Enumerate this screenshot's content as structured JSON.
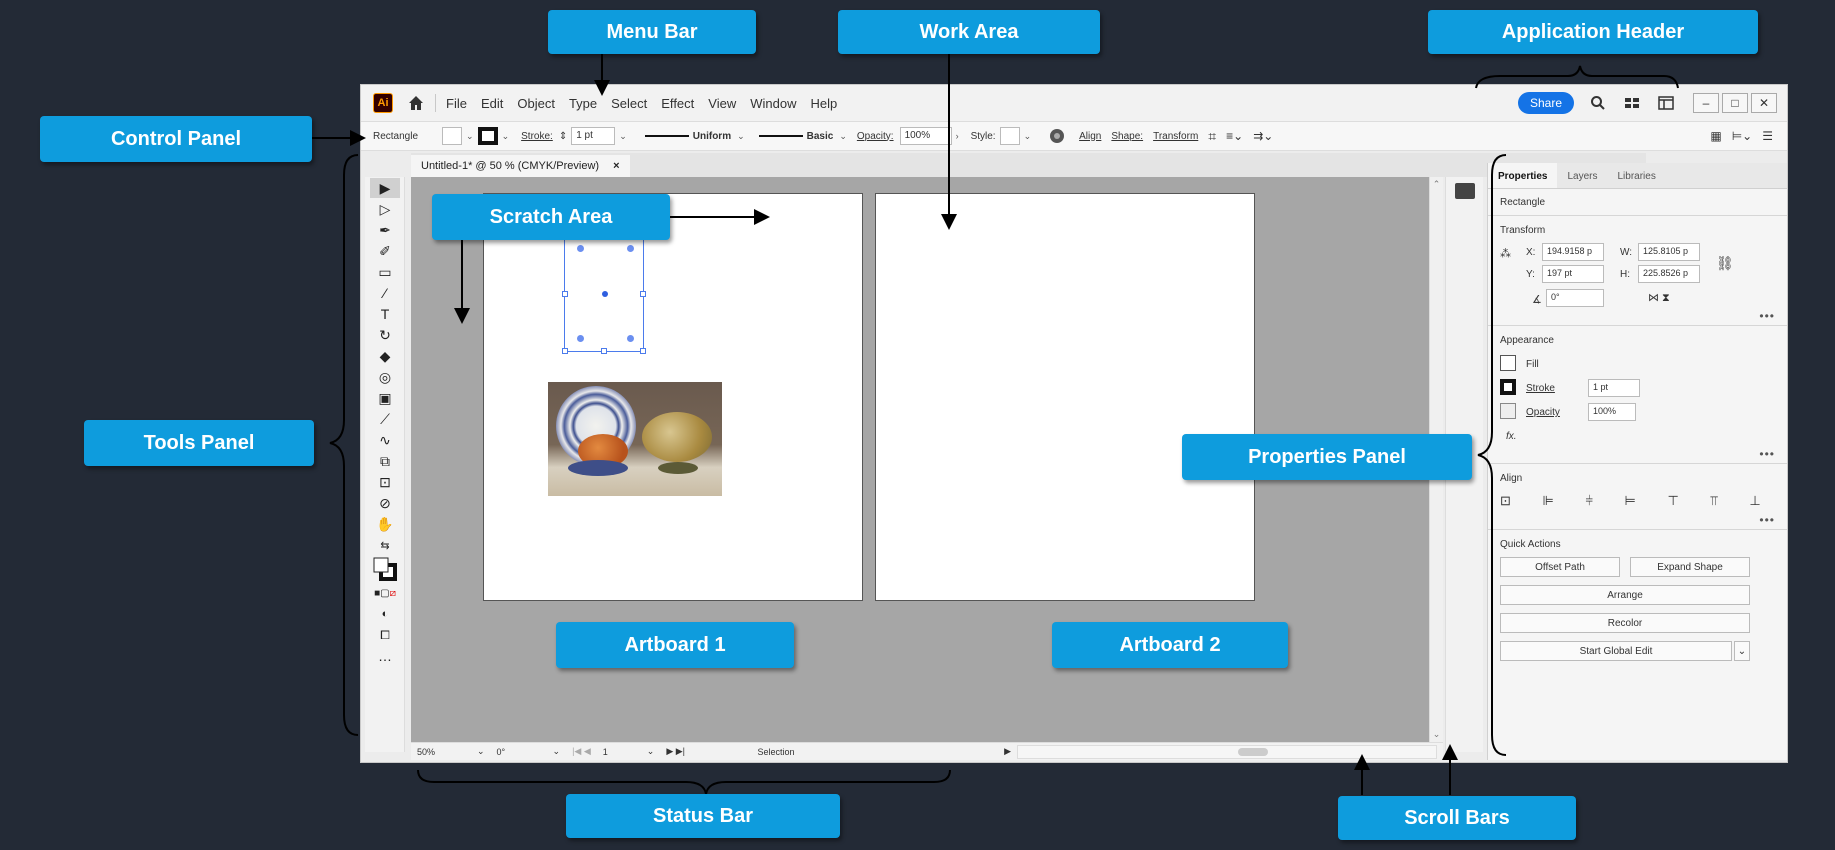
{
  "callouts": {
    "menu_bar": "Menu Bar",
    "work_area": "Work Area",
    "application_header": "Application Header",
    "control_panel": "Control Panel",
    "scratch_area": "Scratch Area",
    "tools_panel": "Tools Panel",
    "properties_panel": "Properties Panel",
    "artboard_1": "Artboard 1",
    "artboard_2": "Artboard 2",
    "status_bar": "Status Bar",
    "scroll_bars": "Scroll Bars"
  },
  "header": {
    "logo": "Ai",
    "menu": [
      "File",
      "Edit",
      "Object",
      "Type",
      "Select",
      "Effect",
      "View",
      "Window",
      "Help"
    ],
    "share_label": "Share"
  },
  "control_panel": {
    "object_label": "Rectangle",
    "stroke_label": "Stroke:",
    "stroke_value": "1 pt",
    "profile_label": "Uniform",
    "brush_label": "Basic",
    "opacity_label": "Opacity:",
    "opacity_value": "100%",
    "style_label": "Style:",
    "align_label": "Align",
    "shape_label": "Shape:",
    "transform_label": "Transform"
  },
  "document": {
    "tab_title": "Untitled-1* @ 50 % (CMYK/Preview)",
    "close": "×"
  },
  "status_bar": {
    "zoom": "50%",
    "rotation": "0°",
    "artboard_num": "1",
    "tool": "Selection"
  },
  "properties": {
    "tabs": [
      "Properties",
      "Layers",
      "Libraries"
    ],
    "object_label": "Rectangle",
    "transform_title": "Transform",
    "x_label": "X:",
    "x_value": "194.9158 p",
    "y_label": "Y:",
    "y_value": "197 pt",
    "w_label": "W:",
    "w_value": "125.8105 p",
    "h_label": "H:",
    "h_value": "225.8526 p",
    "angle_value": "0°",
    "appearance_title": "Appearance",
    "fill_label": "Fill",
    "stroke_label": "Stroke",
    "stroke_value": "1 pt",
    "opacity_label": "Opacity",
    "opacity_value": "100%",
    "fx_label": "fx.",
    "align_title": "Align",
    "quick_actions_title": "Quick Actions",
    "offset_path": "Offset Path",
    "expand_shape": "Expand Shape",
    "arrange": "Arrange",
    "recolor": "Recolor",
    "global_edit": "Start Global Edit"
  },
  "colors": {
    "callout": "#0e9cdd",
    "background": "#232a36",
    "accent": "#1473e6",
    "canvas": "#a6a6a6"
  }
}
